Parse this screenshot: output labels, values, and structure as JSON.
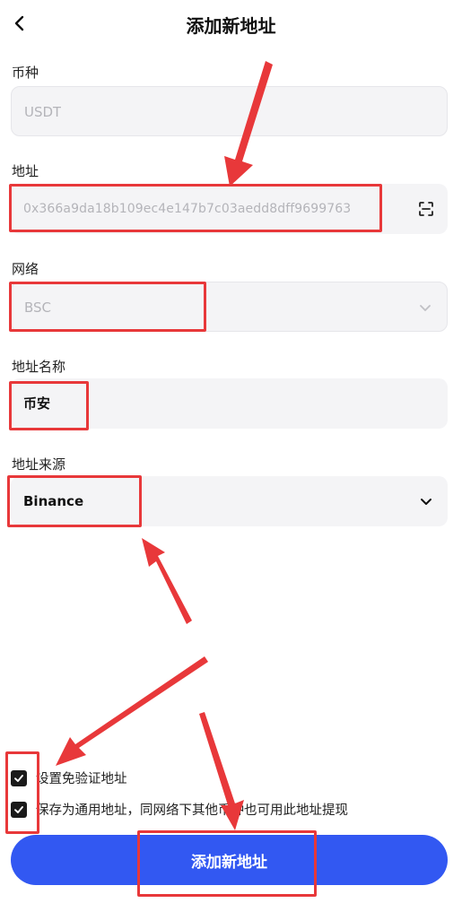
{
  "header": {
    "title": "添加新地址"
  },
  "form": {
    "currency": {
      "label": "币种",
      "value": "USDT"
    },
    "address": {
      "label": "地址",
      "value": "0x366a9da18b109ec4e147b7c03aedd8dff9699763"
    },
    "network": {
      "label": "网络",
      "value": "BSC"
    },
    "address_name": {
      "label": "地址名称",
      "value": "币安"
    },
    "address_source": {
      "label": "地址来源",
      "value": "Binance"
    }
  },
  "options": {
    "skip_verification": {
      "label": "设置免验证地址",
      "checked": true
    },
    "universal_address": {
      "label": "保存为通用地址，同网络下其他币种也可用此地址提现",
      "checked": true
    }
  },
  "submit": {
    "label": "添加新地址"
  },
  "colors": {
    "primary": "#3258f2",
    "annotation": "#e8383a"
  },
  "icons": [
    "back-arrow-icon",
    "scan-icon",
    "chevron-down-icon",
    "check-icon"
  ]
}
